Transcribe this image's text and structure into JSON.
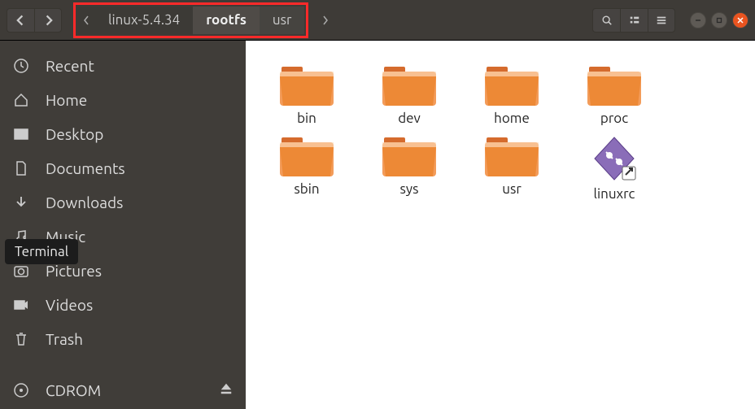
{
  "breadcrumb": {
    "prev": "linux-5.4.34",
    "active": "rootfs",
    "next": "usr"
  },
  "sidebar": {
    "items": [
      {
        "label": "Recent"
      },
      {
        "label": "Home"
      },
      {
        "label": "Desktop"
      },
      {
        "label": "Documents"
      },
      {
        "label": "Downloads"
      },
      {
        "label": "Music"
      },
      {
        "label": "Pictures"
      },
      {
        "label": "Videos"
      },
      {
        "label": "Trash"
      },
      {
        "label": "CDROM"
      }
    ]
  },
  "tooltip": "Terminal",
  "files": [
    {
      "name": "bin",
      "type": "folder"
    },
    {
      "name": "dev",
      "type": "folder"
    },
    {
      "name": "home",
      "type": "folder"
    },
    {
      "name": "proc",
      "type": "folder"
    },
    {
      "name": "sbin",
      "type": "folder"
    },
    {
      "name": "sys",
      "type": "folder"
    },
    {
      "name": "usr",
      "type": "folder"
    },
    {
      "name": "linuxrc",
      "type": "link"
    }
  ]
}
